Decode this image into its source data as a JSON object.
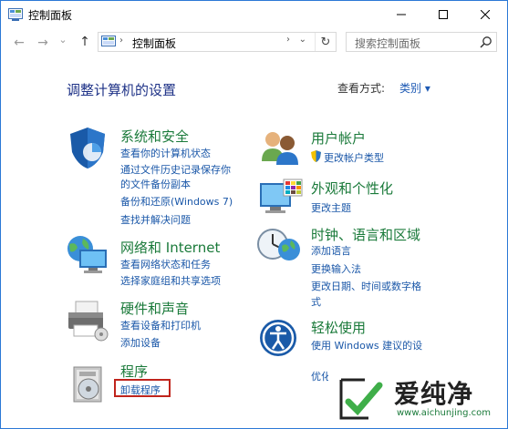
{
  "window": {
    "title": "控制面板",
    "minimize": "—",
    "maximize": "☐",
    "close": "✕"
  },
  "nav": {
    "back": "←",
    "forward": "→",
    "recent": "⌄",
    "up": "↑",
    "address": "控制面板",
    "address_sep": "›",
    "address_chevron": "›",
    "dropdown": "⌄",
    "refresh": "↻",
    "search_placeholder": "搜索控制面板"
  },
  "main": {
    "heading": "调整计算机的设置",
    "view_by_label": "查看方式:",
    "view_by_value": "类别 ▾"
  },
  "categories": {
    "system": {
      "title": "系统和安全",
      "links": [
        "查看你的计算机状态",
        "通过文件历史记录保存你",
        "的文件备份副本",
        "备份和还原(Windows 7)",
        "查找并解决问题"
      ]
    },
    "network": {
      "title": "网络和 Internet",
      "links": [
        "查看网络状态和任务",
        "选择家庭组和共享选项"
      ]
    },
    "hardware": {
      "title": "硬件和声音",
      "links": [
        "查看设备和打印机",
        "添加设备"
      ]
    },
    "programs": {
      "title": "程序",
      "links": [
        "卸载程序"
      ]
    },
    "accounts": {
      "title": "用户帐户",
      "links": [
        "更改帐户类型"
      ]
    },
    "appearance": {
      "title": "外观和个性化",
      "links": [
        "更改主题"
      ]
    },
    "clock": {
      "title": "时钟、语言和区域",
      "links": [
        "添加语言",
        "更换输入法",
        "更改日期、时间或数字格",
        "式"
      ]
    },
    "ease": {
      "title": "轻松使用",
      "links": [
        "使用 Windows 建议的设",
        "优化视觉显示"
      ]
    }
  },
  "watermark": {
    "text": "爱纯净",
    "url": "www.aichunjing.com"
  }
}
